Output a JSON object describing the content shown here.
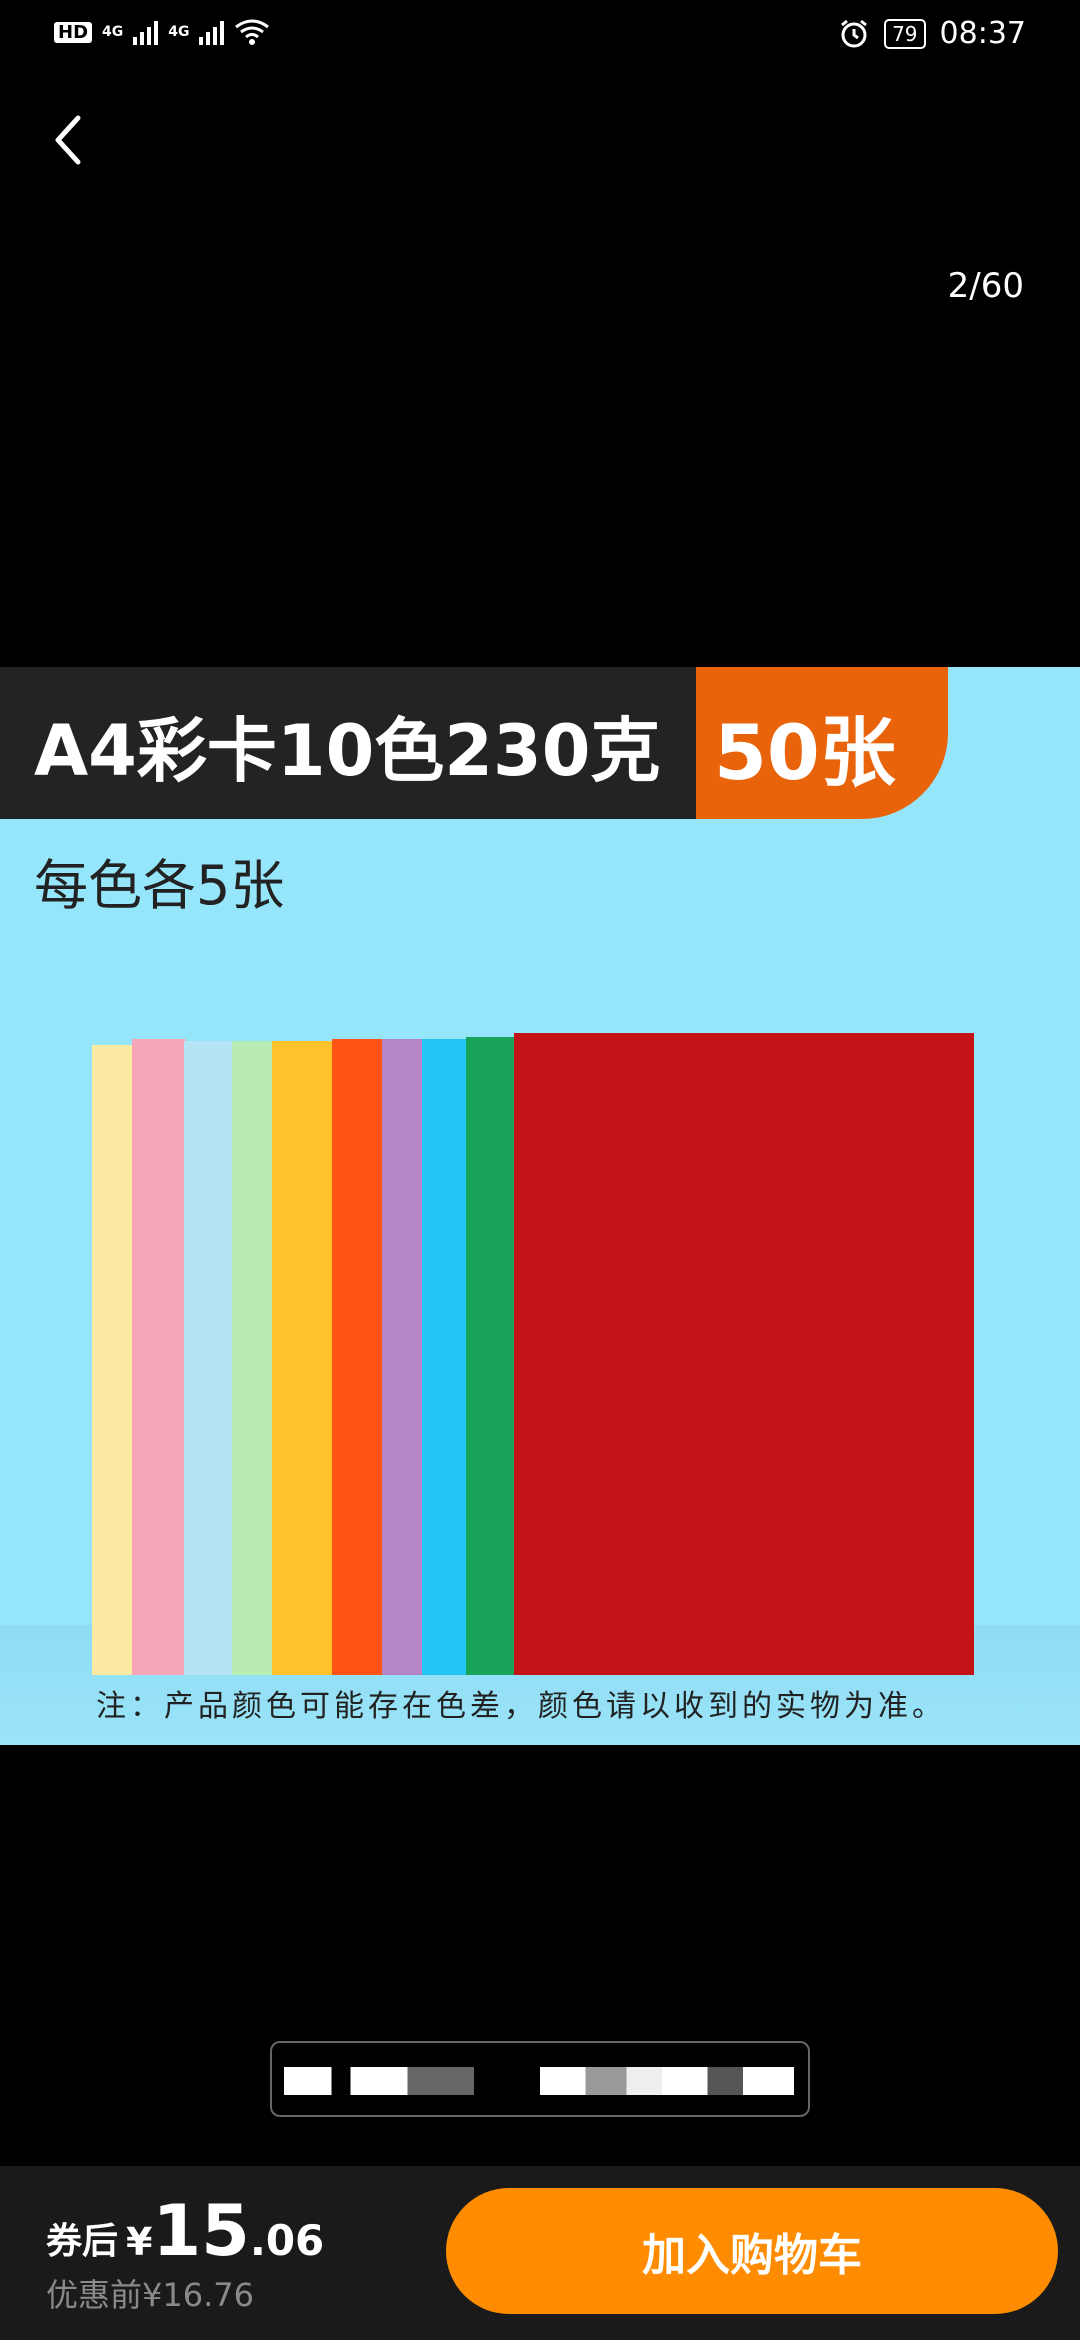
{
  "status_bar": {
    "hd_label": "HD",
    "net1": "4G",
    "net2": "4G",
    "battery": "79",
    "time": "08:37"
  },
  "viewer": {
    "back_icon": "chevron-left-icon",
    "counter": "2/60"
  },
  "product_image": {
    "title": "A4彩卡10色230克",
    "count_badge": "50张",
    "subtitle": "每色各5张",
    "note": "注：产品颜色可能存在色差，颜色请以收到的实物为准。",
    "sheet_colors": [
      "#fce9a2",
      "#f6a6b6",
      "#b5e4f4",
      "#b9ecb2",
      "#ffc22a",
      "#ff5415",
      "#b585c8",
      "#22c5f4",
      "#1aa35a",
      "#c31316"
    ],
    "badge_color": "#e8630a",
    "title_bg": "#232323",
    "background_color": "#96e6fb"
  },
  "bottom_bar": {
    "coupon_label": "券后",
    "currency": "¥",
    "price_int": "15",
    "price_dec": ".06",
    "original_price": "优惠前¥16.76",
    "cart_button": "加入购物车",
    "button_color": "#ff8c00"
  }
}
